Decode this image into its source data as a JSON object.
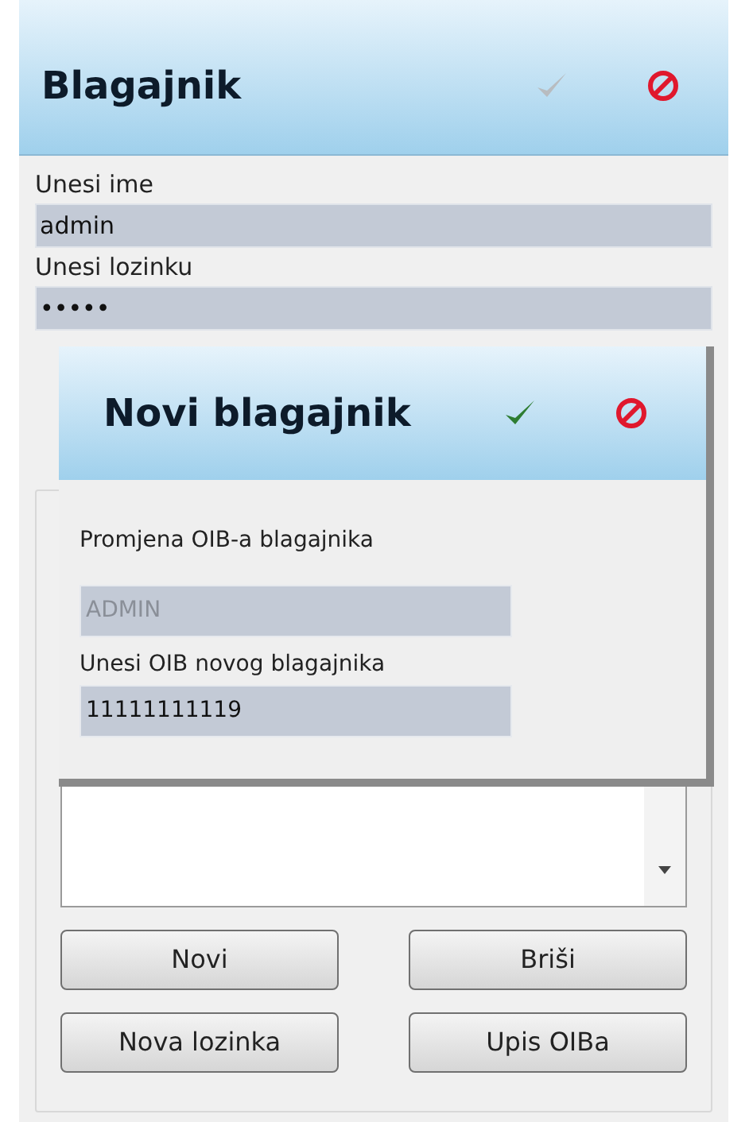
{
  "window": {
    "title": "Blagajnik",
    "confirm_disabled": true
  },
  "fields": [
    {
      "label": "Unesi ime",
      "value": "admin"
    },
    {
      "label": "Unesi lozinku",
      "value": "•••••"
    }
  ],
  "buttons": [
    {
      "label": "Novi"
    },
    {
      "label": "Briši"
    },
    {
      "label": "Nova lozinka"
    },
    {
      "label": "Upis OIBa"
    }
  ],
  "dialog": {
    "title": "Novi blagajnik",
    "confirm_disabled": false,
    "subtitle": "Promjena OIB-a blagajnika",
    "fields": [
      {
        "value": "ADMIN",
        "disabled": true
      },
      {
        "label": "Unesi OIB novog blagajnika",
        "value": "11111111119",
        "disabled": false
      }
    ]
  }
}
